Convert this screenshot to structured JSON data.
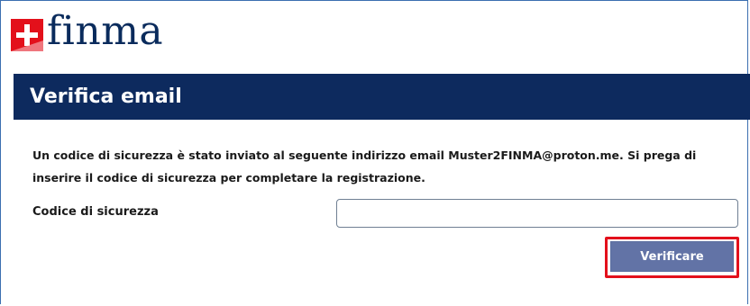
{
  "logo": {
    "text": "finma",
    "icon": "swiss-flag-icon"
  },
  "header": {
    "title": "Verifica email"
  },
  "main": {
    "message": "Un codice di sicurezza è stato inviato al seguente indirizzo email Muster2FINMA@proton.me. Si prega di inserire il codice di sicurezza per completare la registrazione.",
    "code_label": "Codice di sicurezza",
    "code_value": "",
    "code_placeholder": "",
    "verify_label": "Verificare"
  },
  "colors": {
    "header_background": "#0d2a5e",
    "button_background": "#6273a6",
    "highlight_border": "#e3101b",
    "flag_red": "#e3101b"
  }
}
